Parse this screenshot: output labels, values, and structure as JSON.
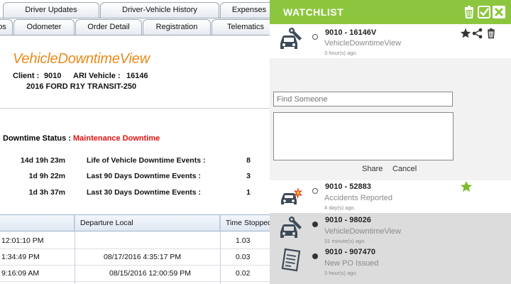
{
  "tabs_row1": [
    "Driver Updates",
    "Driver-Vehicle History",
    "Expenses"
  ],
  "tabs_row2": [
    "os",
    "Odometer",
    "Order Detail",
    "Registration",
    "Telematics"
  ],
  "page_title": "VehicleDowntimeView",
  "client": {
    "label": "Client :",
    "value": "9010",
    "vehicle_label": "ARI Vehicle :",
    "vehicle_value": "16146",
    "description": "2016 FORD R1Y TRANSIT-250"
  },
  "downtime": {
    "status_label": "Downtime Status :",
    "status_value": "Maintenance Downtime",
    "metrics": [
      {
        "duration": "14d 19h 23m",
        "label": "Life of Vehicle Downtime Events :",
        "value": "8"
      },
      {
        "duration": "1d 9h 22m",
        "label": "Last 90 Days Downtime Events :",
        "value": "3"
      },
      {
        "duration": "1d 3h 37m",
        "label": "Last 30 Days Downtime Events :",
        "value": "1"
      }
    ]
  },
  "grid": {
    "headers": [
      "",
      "Departure Local",
      "Time Stopped"
    ],
    "rows": [
      {
        "c1": "12:01:10 PM",
        "c2": "",
        "c3": "1.03"
      },
      {
        "c1": "1:34:49 PM",
        "c2": "08/17/2016 4:35:17 PM",
        "c3": "0.03"
      },
      {
        "c1": "9:16:09 AM",
        "c2": "08/15/2016 12:00:59 PM",
        "c3": "0.02"
      }
    ]
  },
  "watchlist": {
    "title": "WATCHLIST",
    "colors": {
      "header": "#8cc63e",
      "star_active": "#8cc63e"
    },
    "items": [
      {
        "title": "9010 - 16146V",
        "subtitle": "VehicleDowntimeView",
        "time": "3 hour(s) ago.",
        "icon": "vehicle-wrench-icon"
      },
      {
        "title": "9010 - 52883",
        "subtitle": "Accidents Reported",
        "time": "4 day(s) ago.",
        "icon": "car-crash-icon"
      },
      {
        "title": "9010 - 98026",
        "subtitle": "VehicleDowntimeView",
        "time": "31 minute(s) ago.",
        "icon": "vehicle-wrench-icon"
      },
      {
        "title": "9010 - 907470",
        "subtitle": "New PO Issued",
        "time": "3 hour(s) ago.",
        "icon": "document-icon"
      }
    ],
    "share": {
      "placeholder": "Find Someone",
      "share_label": "Share",
      "cancel_label": "Cancel"
    }
  }
}
